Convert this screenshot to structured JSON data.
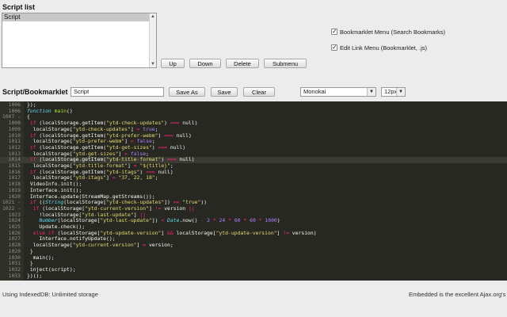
{
  "script_list": {
    "title": "Script list",
    "items": [
      "Script"
    ],
    "selected": "Script"
  },
  "list_buttons": {
    "up": "Up",
    "down": "Down",
    "delete": "Delete",
    "submenu": "Submenu"
  },
  "options": {
    "bookmarklet_menu": {
      "label": "Bookmarklet Menu (Search Bookmarks)",
      "checked": true
    },
    "edit_link_menu": {
      "label": "Edit Link Menu (Bookmarklet, .js)",
      "checked": true
    }
  },
  "editor_bar": {
    "title": "Script/Bookmarklet",
    "name_value": "Script",
    "save_as": "Save As",
    "save": "Save",
    "clear": "Clear",
    "theme": "Monokai",
    "font_size": "12px"
  },
  "code": {
    "active_line": "1014",
    "lines": [
      {
        "n": "1006",
        "t": [
          [
            "p",
            "});"
          ]
        ]
      },
      {
        "n": "1006",
        "t": [
          [
            "it",
            "function "
          ],
          [
            "fn",
            "main"
          ],
          [
            "p",
            "()"
          ]
        ]
      },
      {
        "n": "1007 -",
        "t": [
          [
            "p",
            "{"
          ]
        ]
      },
      {
        "n": "1008",
        "t": [
          [
            "kw",
            " if "
          ],
          [
            "p",
            "(localStorage.getItem("
          ],
          [
            "str",
            "\"ytd-check-updates\""
          ],
          [
            "p",
            ") "
          ],
          [
            "kw",
            "==="
          ],
          [
            "p",
            " null)"
          ]
        ]
      },
      {
        "n": "1009",
        "t": [
          [
            "p",
            "  localStorage["
          ],
          [
            "str",
            "\"ytd-check-updates\""
          ],
          [
            "p",
            "] "
          ],
          [
            "kw",
            "="
          ],
          [
            "p",
            " "
          ],
          [
            "num",
            "true"
          ],
          [
            "p",
            ";"
          ]
        ]
      },
      {
        "n": "1010",
        "t": [
          [
            "kw",
            " if "
          ],
          [
            "p",
            "(localStorage.getItem("
          ],
          [
            "str",
            "\"ytd-prefer-webm\""
          ],
          [
            "p",
            ") "
          ],
          [
            "kw",
            "==="
          ],
          [
            "p",
            " null)"
          ]
        ]
      },
      {
        "n": "1011",
        "t": [
          [
            "p",
            "  localStorage["
          ],
          [
            "str",
            "\"ytd-prefer-webm\""
          ],
          [
            "p",
            "] "
          ],
          [
            "kw",
            "="
          ],
          [
            "p",
            " "
          ],
          [
            "num",
            "false"
          ],
          [
            "p",
            ";"
          ]
        ]
      },
      {
        "n": "1012",
        "t": [
          [
            "kw",
            " if "
          ],
          [
            "p",
            "(localStorage.getItem("
          ],
          [
            "str",
            "\"ytd-get-sizes\""
          ],
          [
            "p",
            ") "
          ],
          [
            "kw",
            "==="
          ],
          [
            "p",
            " null)"
          ]
        ]
      },
      {
        "n": "1013",
        "t": [
          [
            "p",
            "  localStorage["
          ],
          [
            "str",
            "\"ytd-get-sizes\""
          ],
          [
            "p",
            "] "
          ],
          [
            "kw",
            "="
          ],
          [
            "p",
            " "
          ],
          [
            "num",
            "false"
          ],
          [
            "p",
            ";"
          ]
        ]
      },
      {
        "n": "1014",
        "t": [
          [
            "kw",
            " if "
          ],
          [
            "p",
            "(localStorage.getItem("
          ],
          [
            "str",
            "\"ytd-title-format\""
          ],
          [
            "p",
            ") "
          ],
          [
            "kw",
            "==="
          ],
          [
            "p",
            " null)"
          ]
        ]
      },
      {
        "n": "1015",
        "t": [
          [
            "p",
            "  localStorage["
          ],
          [
            "str",
            "\"ytd-title-format\""
          ],
          [
            "p",
            "] "
          ],
          [
            "kw",
            "="
          ],
          [
            "p",
            " "
          ],
          [
            "str",
            "\"${title}\""
          ],
          [
            "p",
            ";"
          ]
        ]
      },
      {
        "n": "1016",
        "t": [
          [
            "kw",
            " if "
          ],
          [
            "p",
            "(localStorage.getItem("
          ],
          [
            "str",
            "\"ytd-itags\""
          ],
          [
            "p",
            ") "
          ],
          [
            "kw",
            "==="
          ],
          [
            "p",
            " null)"
          ]
        ]
      },
      {
        "n": "1017",
        "t": [
          [
            "p",
            "  localStorage["
          ],
          [
            "str",
            "\"ytd-itags\""
          ],
          [
            "p",
            "] "
          ],
          [
            "kw",
            "="
          ],
          [
            "p",
            " "
          ],
          [
            "str",
            "\"37, 22, 18\""
          ],
          [
            "p",
            ";"
          ]
        ]
      },
      {
        "n": "1018",
        "t": [
          [
            "p",
            " VideoInfo.init();"
          ]
        ]
      },
      {
        "n": "1019",
        "t": [
          [
            "p",
            " Interface.init();"
          ]
        ]
      },
      {
        "n": "1020",
        "t": [
          [
            "p",
            " Interface.update(StreamMap.getStreams());"
          ]
        ]
      },
      {
        "n": "1021 -",
        "t": [
          [
            "kw",
            " if "
          ],
          [
            "p",
            "(("
          ],
          [
            "it",
            "String"
          ],
          [
            "p",
            "(localStorage["
          ],
          [
            "str",
            "\"ytd-check-updates\""
          ],
          [
            "p",
            "]) "
          ],
          [
            "kw",
            "=="
          ],
          [
            "p",
            " "
          ],
          [
            "str",
            "\"true\""
          ],
          [
            "p",
            "))"
          ]
        ]
      },
      {
        "n": "1022 -",
        "t": [
          [
            "kw",
            "  if "
          ],
          [
            "p",
            "(localStorage["
          ],
          [
            "str",
            "\"ytd-current-version\""
          ],
          [
            "p",
            "] "
          ],
          [
            "kw",
            "!="
          ],
          [
            "p",
            " version "
          ],
          [
            "kw",
            "||"
          ]
        ]
      },
      {
        "n": "1023",
        "t": [
          [
            "p",
            "    !localStorage["
          ],
          [
            "str",
            "\"ytd-last-update\""
          ],
          [
            "p",
            "] "
          ],
          [
            "kw",
            "||"
          ]
        ]
      },
      {
        "n": "1024",
        "t": [
          [
            "p",
            "    "
          ],
          [
            "it",
            "Number"
          ],
          [
            "p",
            "(localStorage["
          ],
          [
            "str",
            "\"ytd-last-update\""
          ],
          [
            "p",
            "]) "
          ],
          [
            "kw",
            "<"
          ],
          [
            "p",
            " "
          ],
          [
            "it",
            "Date"
          ],
          [
            "p",
            ".now() "
          ],
          [
            "kw",
            "-"
          ],
          [
            "p",
            " "
          ],
          [
            "num",
            "2"
          ],
          [
            "p",
            " "
          ],
          [
            "kw",
            "*"
          ],
          [
            "p",
            " "
          ],
          [
            "num",
            "24"
          ],
          [
            "p",
            " "
          ],
          [
            "kw",
            "*"
          ],
          [
            "p",
            " "
          ],
          [
            "num",
            "60"
          ],
          [
            "p",
            " "
          ],
          [
            "kw",
            "*"
          ],
          [
            "p",
            " "
          ],
          [
            "num",
            "60"
          ],
          [
            "p",
            " "
          ],
          [
            "kw",
            "*"
          ],
          [
            "p",
            " "
          ],
          [
            "num",
            "1000"
          ],
          [
            "p",
            ")"
          ]
        ]
      },
      {
        "n": "1025",
        "t": [
          [
            "p",
            "    Update.check();"
          ]
        ]
      },
      {
        "n": "1026",
        "t": [
          [
            "kw",
            "  else if "
          ],
          [
            "p",
            "(localStorage["
          ],
          [
            "str",
            "\"ytd-update-version\""
          ],
          [
            "p",
            "] "
          ],
          [
            "kw",
            "&&"
          ],
          [
            "p",
            " localStorage["
          ],
          [
            "str",
            "\"ytd-update-version\""
          ],
          [
            "p",
            "] "
          ],
          [
            "kw",
            "!="
          ],
          [
            "p",
            " version)"
          ]
        ]
      },
      {
        "n": "1027",
        "t": [
          [
            "p",
            "    Interface.notifyUpdate();"
          ]
        ]
      },
      {
        "n": "1028",
        "t": [
          [
            "p",
            "  localStorage["
          ],
          [
            "str",
            "\"ytd-current-version\""
          ],
          [
            "p",
            "] "
          ],
          [
            "kw",
            "="
          ],
          [
            "p",
            " version;"
          ]
        ]
      },
      {
        "n": "1029",
        "t": [
          [
            "p",
            " }"
          ]
        ]
      },
      {
        "n": "1030",
        "t": [
          [
            "p",
            "  main();"
          ]
        ]
      },
      {
        "n": "1031",
        "t": [
          [
            "p",
            " }"
          ]
        ]
      },
      {
        "n": "1032",
        "t": [
          [
            "p",
            " inject(script);"
          ]
        ]
      },
      {
        "n": "1033",
        "t": [
          [
            "p",
            "})();"
          ]
        ]
      }
    ]
  },
  "status": {
    "left": "Using IndexedDB: Unlimited storage",
    "right": "Embedded is the excellent Ajax.org's"
  },
  "colors": {
    "editor_bg": "#272822",
    "gutter_bg": "#2f3129",
    "keyword": "#f92672",
    "string": "#e6db74",
    "function": "#a6e22e",
    "number": "#ae81ff",
    "type": "#66d9ef"
  }
}
